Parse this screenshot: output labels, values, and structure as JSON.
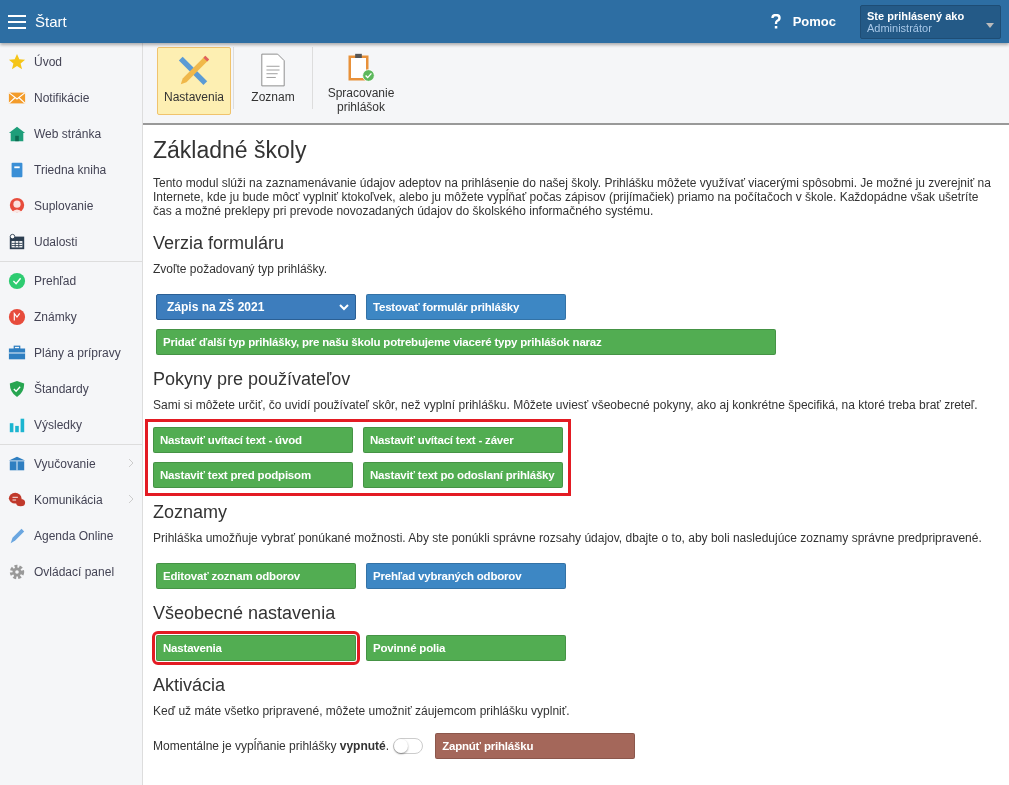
{
  "header": {
    "title": "Štart",
    "help": "Pomoc",
    "user_label": "Ste prihlásený ako",
    "user_name": "Administrátor"
  },
  "sidebar": {
    "groups": [
      {
        "items": [
          {
            "label": "Úvod",
            "submenu": false
          },
          {
            "label": "Notifikácie",
            "submenu": false
          },
          {
            "label": "Web stránka",
            "submenu": false
          },
          {
            "label": "Triedna kniha",
            "submenu": false
          },
          {
            "label": "Suplovanie",
            "submenu": false
          },
          {
            "label": "Udalosti",
            "submenu": false
          }
        ]
      },
      {
        "items": [
          {
            "label": "Prehľad",
            "submenu": false
          },
          {
            "label": "Známky",
            "submenu": false
          },
          {
            "label": "Plány a prípravy",
            "submenu": false
          },
          {
            "label": "Štandardy",
            "submenu": false
          },
          {
            "label": "Výsledky",
            "submenu": false
          }
        ]
      },
      {
        "items": [
          {
            "label": "Vyučovanie",
            "submenu": true
          },
          {
            "label": "Komunikácia",
            "submenu": true
          },
          {
            "label": "Agenda Online",
            "submenu": false
          },
          {
            "label": "Ovládací panel",
            "submenu": false
          }
        ]
      }
    ]
  },
  "toolbar": [
    {
      "label": "Nastavenia",
      "selected": true
    },
    {
      "label": "Zoznam",
      "selected": false
    },
    {
      "label": "Spracovanie prihlášok",
      "selected": false
    }
  ],
  "page": {
    "title": "Základné školy",
    "intro": "Tento modul slúži na zaznamenávanie údajov adeptov na prihlásenie do našej školy. Prihlášku môžete využívať viacerými spôsobmi. Je možné ju zverejniť na Internete, kde ju bude môcť vyplniť ktokoľvek, alebo ju môžete vypĺňať počas zápisov (prijímačiek) priamo na počítačoch v škole. Každopádne však ušetríte čas a možné preklepy pri prevode novozadaných údajov do školského informačného systému."
  },
  "sections": [
    {
      "heading": "Verzia formuláru",
      "text": "Zvoľte požadovaný typ prihlášky.",
      "groups": [
        {
          "highlighted": false,
          "rows": [
            [
              {
                "kind": "select",
                "label": "Zápis na ZŠ 2021"
              },
              {
                "kind": "primary",
                "label": "Testovať formulár prihlášky"
              }
            ],
            [
              {
                "kind": "success-wide",
                "label": "Pridať ďalší typ prihlášky, pre našu školu potrebujeme viaceré typy prihlášok naraz"
              }
            ]
          ]
        }
      ]
    },
    {
      "heading": "Pokyny pre používateľov",
      "text": "Sami si môžete určiť, čo uvidí používateľ skôr, než vyplní prihlášku. Môžete uviesť všeobecné pokyny, ako aj konkrétne špecifiká, na ktoré treba brať zreteľ.",
      "groups": [
        {
          "highlighted": true,
          "rows": [
            [
              {
                "kind": "success",
                "label": "Nastaviť uvítací text - úvod"
              },
              {
                "kind": "success",
                "label": "Nastaviť uvítací text - záver"
              }
            ],
            [
              {
                "kind": "success",
                "label": "Nastaviť text pred podpisom"
              },
              {
                "kind": "success",
                "label": "Nastaviť text po odoslaní prihlášky"
              }
            ]
          ]
        }
      ]
    },
    {
      "heading": "Zoznamy",
      "text": "Prihláška umožňuje vybrať ponúkané možnosti. Aby ste ponúkli správne rozsahy údajov, dbajte o to, aby boli nasledujúce zoznamy správne predpripravené.",
      "groups": [
        {
          "highlighted": false,
          "rows": [
            [
              {
                "kind": "success",
                "label": "Editovať zoznam odborov"
              },
              {
                "kind": "primary",
                "label": "Prehľad vybraných odborov"
              }
            ]
          ]
        }
      ]
    },
    {
      "heading": "Všeobecné nastavenia",
      "groups": [
        {
          "highlighted": false,
          "rows": [
            [
              {
                "kind": "success",
                "label": "Nastavenia",
                "highlighted": true
              },
              {
                "kind": "success",
                "label": "Povinné polia",
                "highlighted": false
              }
            ]
          ]
        }
      ]
    },
    {
      "heading": "Aktivácia",
      "text": "Keď už máte všetko pripravené, môžete umožniť záujemcom prihlášku vyplniť."
    }
  ],
  "activation": {
    "status": "Momentálne je vypĺňanie prihlášky **vypnuté**.",
    "on": false,
    "button": "Zapnúť prihlášku"
  }
}
